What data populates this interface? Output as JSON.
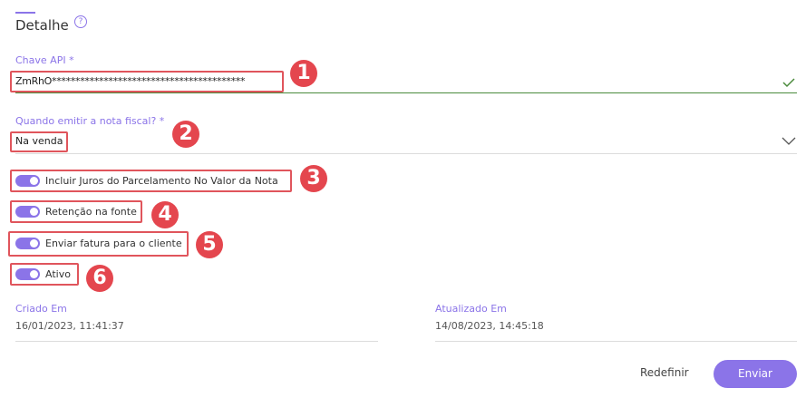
{
  "section": {
    "title": "Detalhe",
    "help_icon": "help-circle-icon"
  },
  "api_key": {
    "label": "Chave API *",
    "value": "ZmRhO*****************************************",
    "valid_icon": "check-icon"
  },
  "emit": {
    "label": "Quando emitir a nota fiscal? *",
    "value": "Na venda",
    "dropdown_icon": "chevron-down-icon"
  },
  "toggles": [
    {
      "label": "Incluir Juros do Parcelamento No Valor da Nota",
      "on": true
    },
    {
      "label": "Retenção na fonte",
      "on": true
    },
    {
      "label": "Enviar fatura para o cliente",
      "on": true
    },
    {
      "label": "Ativo",
      "on": true
    }
  ],
  "badges": [
    "1",
    "2",
    "3",
    "4",
    "5",
    "6"
  ],
  "created": {
    "label": "Criado Em",
    "value": "16/01/2023, 11:41:37"
  },
  "updated": {
    "label": "Atualizado Em",
    "value": "14/08/2023, 14:45:18"
  },
  "actions": {
    "reset_label": "Redefinir",
    "send_label": "Enviar"
  },
  "colors": {
    "accent": "#8b74e8",
    "annotation": "#e4464e",
    "valid": "#4a8a3c"
  }
}
